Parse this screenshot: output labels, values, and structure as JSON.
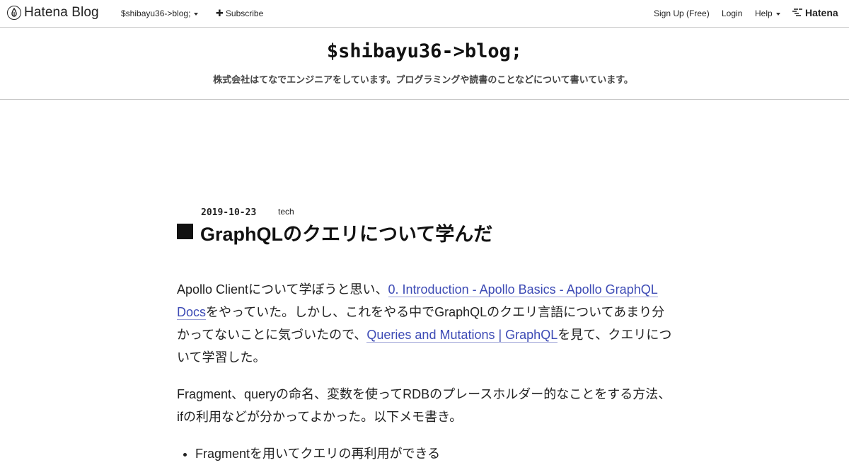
{
  "globalbar": {
    "brand": "Hatena Blog",
    "blog_menu": "$shibayu36->blog;",
    "subscribe": "Subscribe",
    "signup": "Sign Up (Free)",
    "login": "Login",
    "help": "Help",
    "hatena": "Hatena"
  },
  "header": {
    "title": "$shibayu36->blog;",
    "description": "株式会社はてなでエンジニアをしています。プログラミングや読書のことなどについて書いています。"
  },
  "entry": {
    "date": "2019-10-23",
    "category": "tech",
    "title": "GraphQLのクエリについて学んだ",
    "p1": {
      "pre": "Apollo Clientについて学ぼうと思い、",
      "link1": "0. Introduction - Apollo Basics - Apollo GraphQL Docs",
      "mid": "をやっていた。しかし、これをやる中でGraphQLのクエリ言語についてあまり分かってないことに気づいたので、",
      "link2": "Queries and Mutations | GraphQL",
      "post": "を見て、クエリについて学習した。"
    },
    "p2": "Fragment、queryの命名、変数を使ってRDBのプレースホルダー的なことをする方法、ifの利用などが分かってよかった。以下メモ書き。",
    "list": [
      "Fragmentを用いてクエリの再利用ができる"
    ]
  }
}
